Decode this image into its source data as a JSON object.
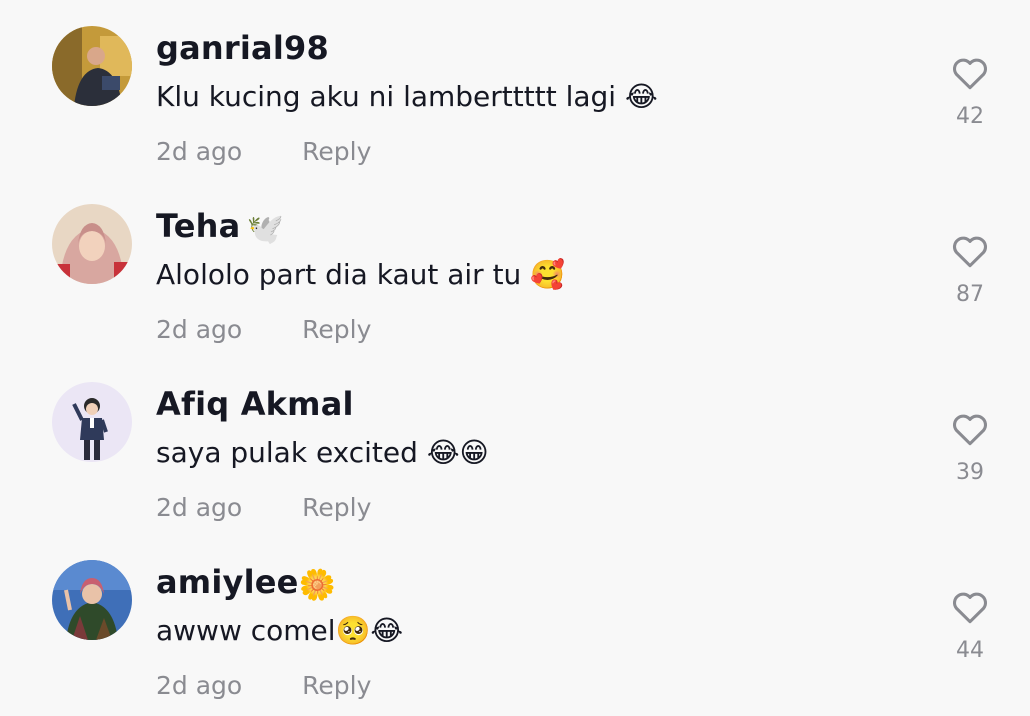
{
  "comments": [
    {
      "username": "ganrial98",
      "name_emoji": "",
      "text": "Klu kucing aku ni lamberttttt lagi 😂",
      "time": "2d ago",
      "reply_label": "Reply",
      "likes": "42"
    },
    {
      "username": "Teha",
      "name_emoji": "🕊️",
      "text": "Alololo part dia kaut air tu 🥰",
      "time": "2d ago",
      "reply_label": "Reply",
      "likes": "87"
    },
    {
      "username": "Afiq Akmal",
      "name_emoji": "",
      "text": "saya pulak excited 😂😁",
      "time": "2d ago",
      "reply_label": "Reply",
      "likes": "39"
    },
    {
      "username": "amiylee",
      "name_emoji": "🌼",
      "text": "awww comel🥺😂",
      "time": "2d ago",
      "reply_label": "Reply",
      "likes": "44"
    }
  ],
  "icons": {
    "like": "heart-outline-icon"
  },
  "colors": {
    "text": "#161823",
    "muted": "#8a8b91",
    "background": "#f8f8f8"
  }
}
